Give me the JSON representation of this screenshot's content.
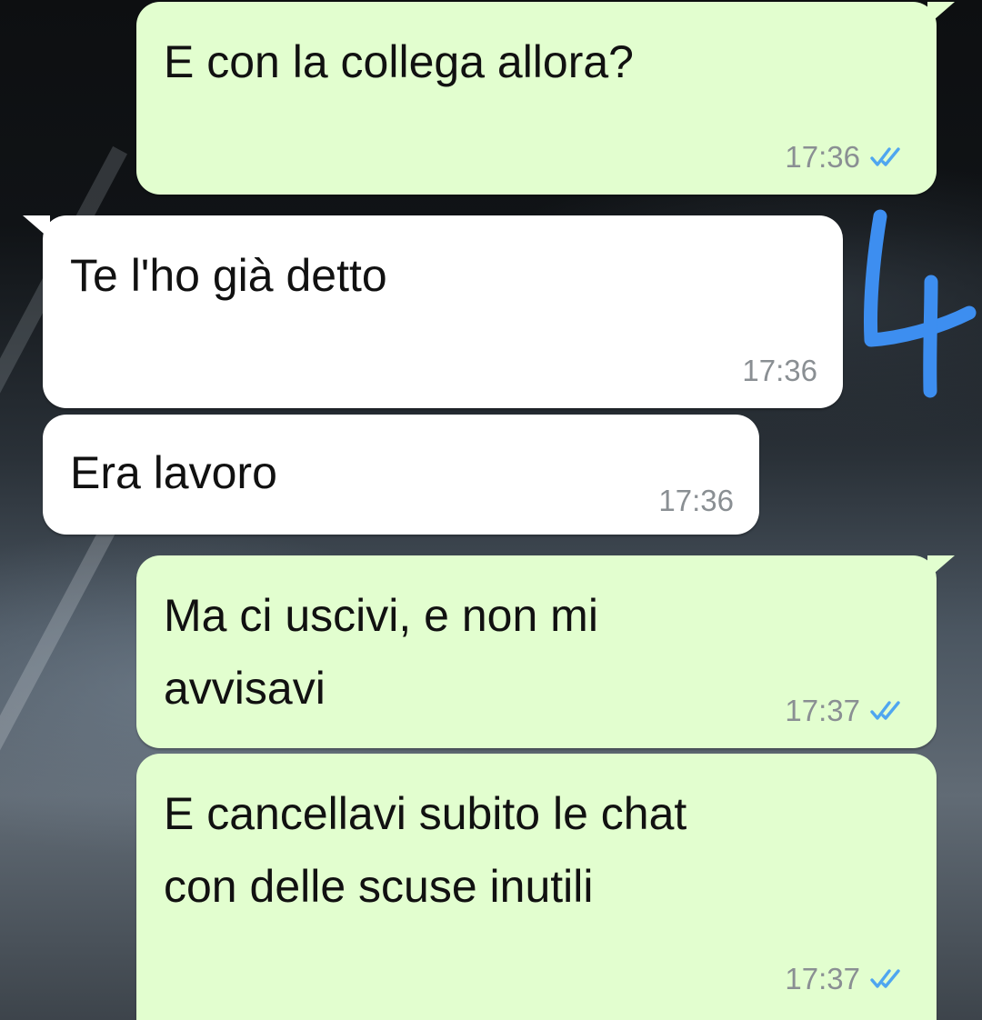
{
  "annotation": {
    "number": "4",
    "color": "#3d8ef0"
  },
  "colors": {
    "outgoing_bubble": "#e2fecf",
    "incoming_bubble": "#ffffff",
    "read_ticks": "#4fa6f0"
  },
  "messages": [
    {
      "direction": "outgoing",
      "text": "E con la collega allora?",
      "time": "17:36",
      "status": "read-ticks-icon"
    },
    {
      "direction": "incoming",
      "text": "Te l'ho già detto",
      "time": "17:36"
    },
    {
      "direction": "incoming",
      "text": "Era lavoro",
      "time": "17:36"
    },
    {
      "direction": "outgoing",
      "text": "Ma ci uscivi, e non mi\navvisavi",
      "time": "17:37",
      "status": "read-ticks-icon"
    },
    {
      "direction": "outgoing",
      "text": "E cancellavi subito le chat\ncon delle scuse inutili",
      "time": "17:37",
      "status": "read-ticks-icon"
    }
  ]
}
